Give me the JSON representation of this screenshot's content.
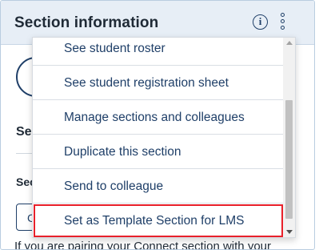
{
  "panel": {
    "title": "Section information",
    "info_icon": "i",
    "colors": {
      "header_bg": "#e7eef6",
      "accent": "#1f3f68",
      "highlight": "#e8202a"
    }
  },
  "background": {
    "line1": "Se",
    "line2": "Sec",
    "button_text": "C",
    "bottom_text": "If you are pairing your Connect section with your"
  },
  "menu": {
    "items": [
      {
        "label": "See student roster"
      },
      {
        "label": "See student registration sheet"
      },
      {
        "label": "Manage sections and colleagues"
      },
      {
        "label": "Duplicate this section"
      },
      {
        "label": "Send to colleague"
      },
      {
        "label": "Set as Template Section for LMS"
      }
    ]
  }
}
